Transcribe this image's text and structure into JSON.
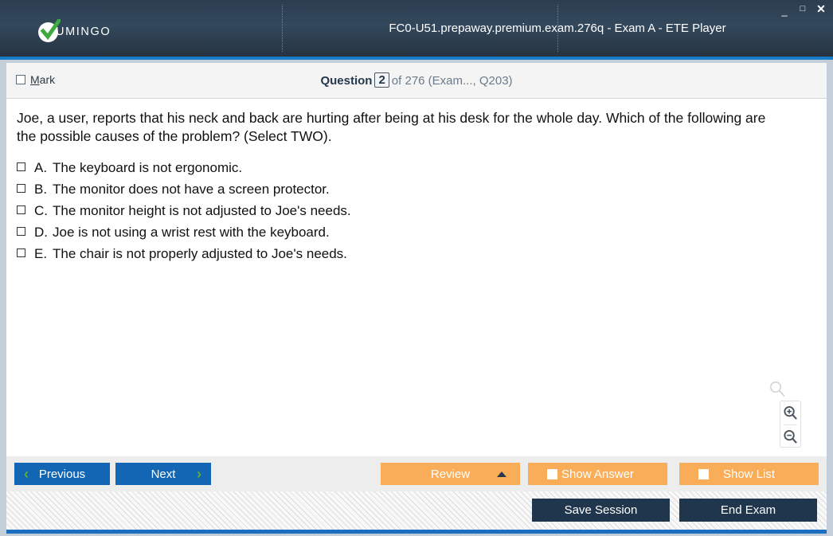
{
  "window": {
    "title": "FC0-U51.prepaway.premium.exam.276q - Exam A - ETE Player",
    "logo_text": "UMINGO",
    "controls": {
      "minimize": "_",
      "maximize": "□",
      "close": "✕"
    },
    "accent_color": "#1a7cc4"
  },
  "question_bar": {
    "mark_label_prefix": "M",
    "mark_label_rest": "ark",
    "question_word": "Question",
    "question_number": "2",
    "counter_rest": "of 276 (Exam..., Q203)"
  },
  "question": {
    "text": "Joe, a user, reports that his neck and back are hurting after being at his desk for the whole day. Which of the following are the possible causes of the problem? (Select TWO).",
    "options": [
      {
        "letter": "A.",
        "text": "The keyboard is not ergonomic.",
        "checked": false
      },
      {
        "letter": "B.",
        "text": "The monitor does not have a screen protector.",
        "checked": false
      },
      {
        "letter": "C.",
        "text": "The monitor height is not adjusted to Joe's needs.",
        "checked": false
      },
      {
        "letter": "D.",
        "text": "Joe is not using a wrist rest with the keyboard.",
        "checked": false
      },
      {
        "letter": "E.",
        "text": "The chair is not properly adjusted to Joe's needs.",
        "checked": false
      }
    ]
  },
  "zoom_controls": {
    "ghost_icon": "magnifier-icon",
    "zoom_in_icon": "magnifier-plus-icon",
    "zoom_out_icon": "magnifier-minus-icon"
  },
  "toolbar": {
    "previous_label": "Previous",
    "next_label": "Next",
    "review_label": "Review",
    "show_answer_label": "Show Answer",
    "show_list_label": "Show List",
    "nav_color": "#1266b3",
    "orange_color": "#f9ad58",
    "chevron_color": "#5cb02c"
  },
  "footer": {
    "save_session_label": "Save Session",
    "end_exam_label": "End Exam",
    "button_color": "#20364c"
  }
}
